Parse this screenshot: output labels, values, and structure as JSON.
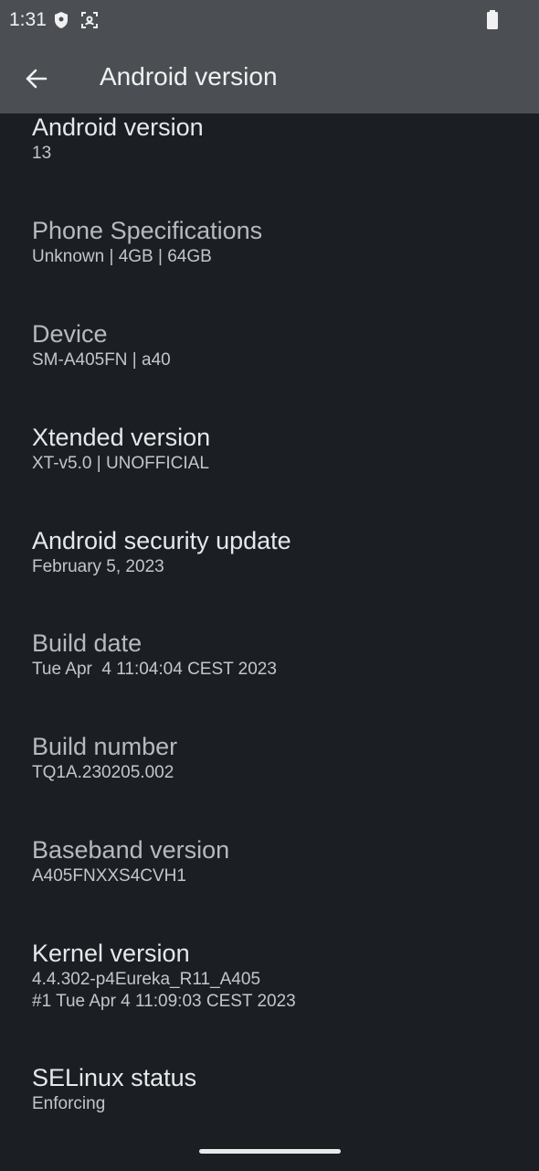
{
  "status_bar": {
    "time": "1:31"
  },
  "app_bar": {
    "title": "Android version"
  },
  "items": [
    {
      "title": "Android version",
      "value": "13"
    },
    {
      "title": "Phone Specifications",
      "value": "Unknown | 4GB | 64GB"
    },
    {
      "title": "Device",
      "value": "SM-A405FN | a40"
    },
    {
      "title": "Xtended version",
      "value": "XT-v5.0 | UNOFFICIAL"
    },
    {
      "title": "Android security update",
      "value": "February 5, 2023"
    },
    {
      "title": "Build date",
      "value": "Tue Apr  4 11:04:04 CEST 2023"
    },
    {
      "title": "Build number",
      "value": "TQ1A.230205.002"
    },
    {
      "title": "Baseband version",
      "value": "A405FNXXS4CVH1"
    },
    {
      "title": "Kernel version",
      "value": "4.4.302-p4Eureka_R11_A405\n#1 Tue Apr 4 11:09:03 CEST 2023"
    },
    {
      "title": "SELinux status",
      "value": "Enforcing"
    }
  ]
}
